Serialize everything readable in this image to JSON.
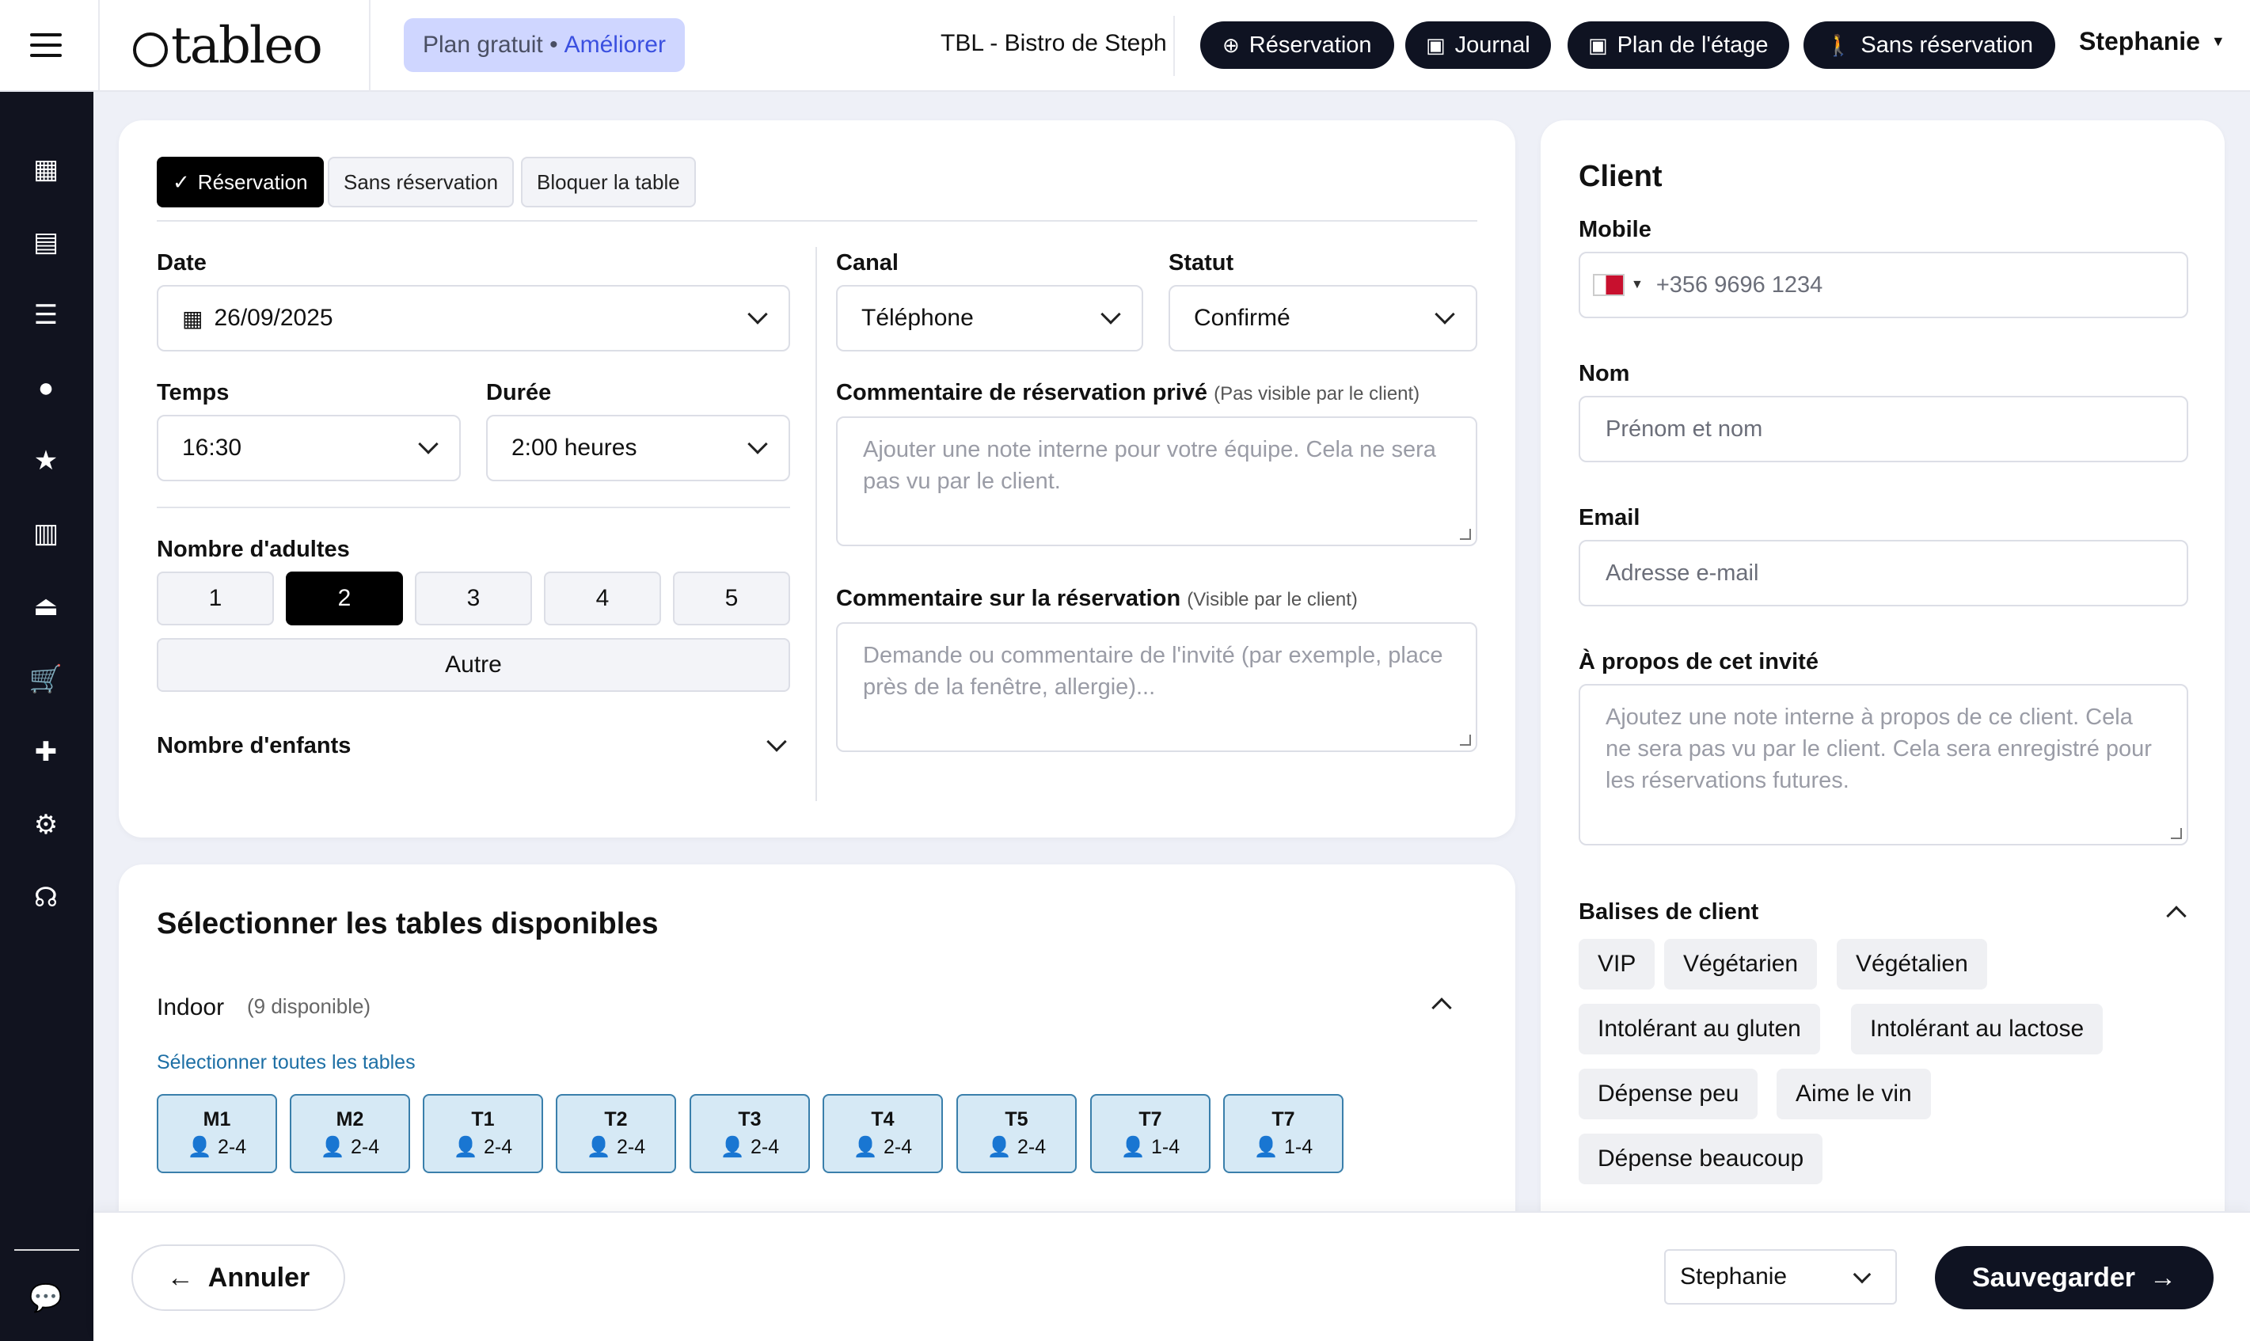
{
  "header": {
    "logo_text": "tableo",
    "plan_label": "Plan gratuit •",
    "upgrade_label": "Améliorer",
    "restaurant": "TBL - Bistro de Steph",
    "buttons": [
      {
        "label": "Réservation",
        "icon": "plus-circle-icon"
      },
      {
        "label": "Journal",
        "icon": "calendar-icon"
      },
      {
        "label": "Plan de l'étage",
        "icon": "calendar-icon"
      },
      {
        "label": "Sans réservation",
        "icon": "walk-icon"
      }
    ],
    "user": "Stephanie"
  },
  "sidebar": {
    "icons": [
      "dashboard-icon",
      "book-icon",
      "list-icon",
      "user-icon",
      "star-icon",
      "chart-icon",
      "cloche-icon",
      "cart-icon",
      "puzzle-icon",
      "gear-icon",
      "headset-icon",
      "chat-icon"
    ]
  },
  "booking": {
    "tabs": [
      "Réservation",
      "Sans réservation",
      "Bloquer la table"
    ],
    "date_label": "Date",
    "date_value": "26/09/2025",
    "time_label": "Temps",
    "time_value": "16:30",
    "duration_label": "Durée",
    "duration_value": "2:00 heures",
    "adults_label": "Nombre d'adultes",
    "adults_options": [
      "1",
      "2",
      "3",
      "4",
      "5"
    ],
    "adults_selected": "2",
    "other_label": "Autre",
    "children_label": "Nombre d'enfants",
    "channel_label": "Canal",
    "channel_value": "Téléphone",
    "status_label": "Statut",
    "status_value": "Confirmé",
    "private_comment_label": "Commentaire de réservation privé",
    "private_comment_hint": "(Pas visible par le client)",
    "private_comment_placeholder": "Ajouter une note interne pour votre équipe. Cela ne sera pas vu par le client.",
    "public_comment_label": "Commentaire sur la réservation",
    "public_comment_hint": "(Visible par le client)",
    "public_comment_placeholder": "Demande ou commentaire de l'invité (par exemple, place près de la fenêtre, allergie)..."
  },
  "tables": {
    "title": "Sélectionner les tables disponibles",
    "area": "Indoor",
    "area_count": "(9 disponible)",
    "select_all": "Sélectionner toutes les tables",
    "items": [
      {
        "name": "M1",
        "capacity": "2-4"
      },
      {
        "name": "M2",
        "capacity": "2-4"
      },
      {
        "name": "T1",
        "capacity": "2-4"
      },
      {
        "name": "T2",
        "capacity": "2-4"
      },
      {
        "name": "T3",
        "capacity": "2-4"
      },
      {
        "name": "T4",
        "capacity": "2-4"
      },
      {
        "name": "T5",
        "capacity": "2-4"
      },
      {
        "name": "T7",
        "capacity": "1-4"
      },
      {
        "name": "T7",
        "capacity": "1-4"
      }
    ]
  },
  "client": {
    "title": "Client",
    "mobile_label": "Mobile",
    "mobile_placeholder": "+356 9696 1234",
    "name_label": "Nom",
    "name_placeholder": "Prénom et nom",
    "email_label": "Email",
    "email_placeholder": "Adresse e-mail",
    "about_label": "À propos de cet invité",
    "about_placeholder": "Ajoutez une note interne à propos de ce client. Cela ne sera pas vu par le client. Cela sera enregistré pour les réservations futures.",
    "tags_label": "Balises de client",
    "tags": [
      "VIP",
      "Végétarien",
      "Végétalien",
      "Intolérant au gluten",
      "Intolérant au lactose",
      "Dépense peu",
      "Aime le vin",
      "Dépense beaucoup"
    ]
  },
  "footer": {
    "cancel_label": "Annuler",
    "staff_value": "Stephanie",
    "save_label": "Sauvegarder"
  },
  "colors": {
    "dark": "#0f1322",
    "plan_badge_bg": "#cfd6ff",
    "link_blue": "#1d6fa5",
    "table_chip_bg": "#d6e9f5",
    "table_chip_border": "#3a7fab"
  }
}
